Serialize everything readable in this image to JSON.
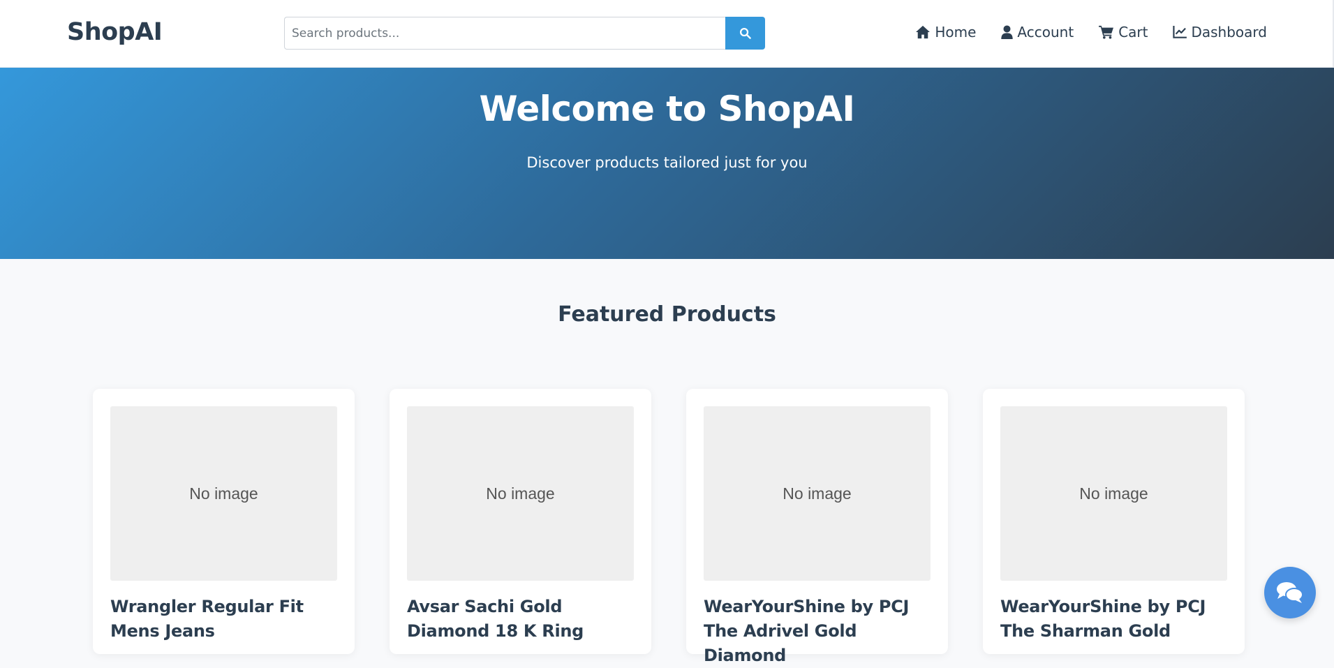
{
  "header": {
    "logo": "ShopAI",
    "search": {
      "placeholder": "Search products...",
      "value": ""
    },
    "nav": [
      {
        "label": "Home",
        "icon": "home-icon"
      },
      {
        "label": "Account",
        "icon": "user-icon"
      },
      {
        "label": "Cart",
        "icon": "cart-icon"
      },
      {
        "label": "Dashboard",
        "icon": "chart-line-icon"
      }
    ]
  },
  "hero": {
    "title": "Welcome to ShopAI",
    "subtitle": "Discover products tailored just for you"
  },
  "featured": {
    "title": "Featured Products",
    "products": [
      {
        "image_text": "No image",
        "name": "Wrangler Regular Fit Mens Jeans"
      },
      {
        "image_text": "No image",
        "name": "Avsar Sachi Gold Diamond 18 K Ring"
      },
      {
        "image_text": "No image",
        "name": "WearYourShine by PCJ The Adrivel Gold Diamond"
      },
      {
        "image_text": "No image",
        "name": "WearYourShine by PCJ The Sharman Gold"
      }
    ]
  },
  "colors": {
    "primary": "#3498db",
    "dark": "#2c3e50",
    "chat": "#4a90e2"
  }
}
